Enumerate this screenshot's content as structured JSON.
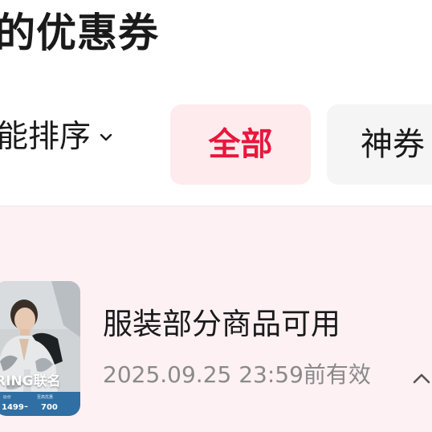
{
  "header": {
    "title": "的优惠券"
  },
  "filters": {
    "sort_label": "能排序",
    "chips": [
      {
        "label": "全部",
        "active": true
      },
      {
        "label": "神券",
        "active": false
      }
    ]
  },
  "coupon": {
    "thumbnail": {
      "brand_text": "RING联名",
      "small_label_1": "原价",
      "small_label_2": "至高优惠",
      "price_1": "1499",
      "separator": "–",
      "price_2": "700"
    },
    "name": "服装部分商品可用",
    "validity": "2025.09.25 23:59前有效"
  },
  "colors": {
    "accent_red": "#e8173c",
    "active_chip_bg": "#fdebee",
    "inactive_chip_bg": "#f5f5f5",
    "panel_bg": "#fdf1f4",
    "text_primary": "#1a1a1a",
    "text_secondary": "#8a8a8a"
  },
  "icons": {
    "sort_dropdown": "chevron-down-icon",
    "expand": "chevron-up-icon"
  }
}
